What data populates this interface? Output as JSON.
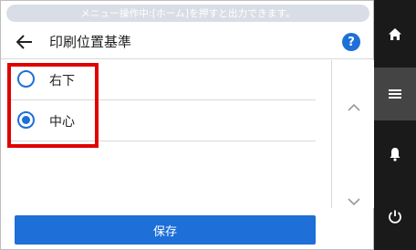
{
  "banner": {
    "text": "メニュー操作中:[ホーム]を押すと出力できます。"
  },
  "header": {
    "title": "印刷位置基準",
    "back_icon": "arrow-left-icon",
    "help_icon": "help-circle-icon",
    "help_glyph": "?"
  },
  "options": [
    {
      "label": "右下",
      "selected": false
    },
    {
      "label": "中心",
      "selected": true
    }
  ],
  "footer": {
    "save_label": "保存"
  },
  "scroll": {
    "up_icon": "chevron-up-icon",
    "down_icon": "chevron-down-icon"
  },
  "rail": [
    {
      "icon": "home-icon"
    },
    {
      "icon": "menu-icon"
    },
    {
      "icon": "bell-icon"
    },
    {
      "icon": "power-icon"
    }
  ],
  "colors": {
    "accent": "#1e6fd8",
    "highlight": "#e00000",
    "rail": "#1a1a1a",
    "rail_active": "#444444",
    "banner": "#d9dee6"
  }
}
